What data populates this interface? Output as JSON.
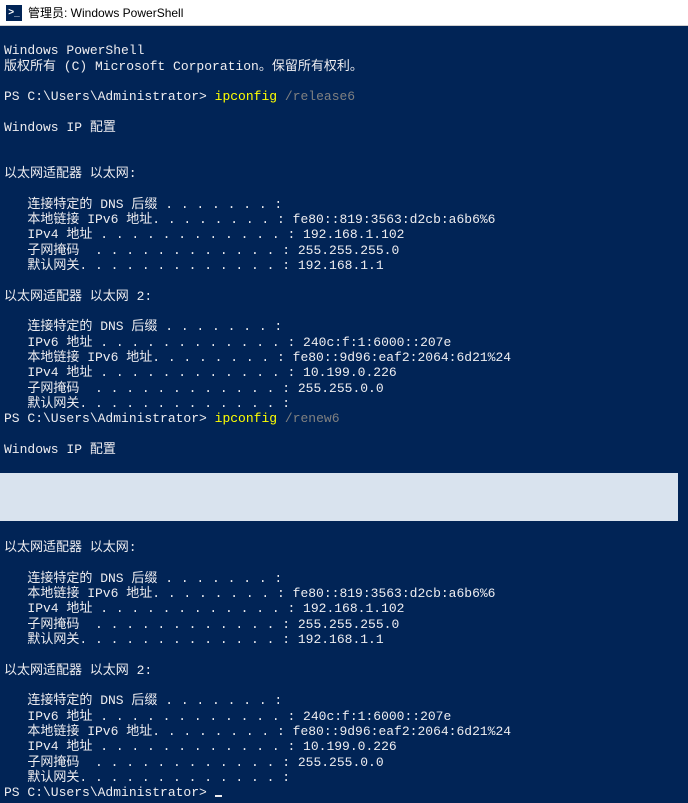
{
  "title_bar": {
    "icon_glyph": ">_",
    "title": "管理员: Windows PowerShell"
  },
  "header": {
    "line1": "Windows PowerShell",
    "line2": "版权所有 (C) Microsoft Corporation。保留所有权利。"
  },
  "prompt": {
    "path": "PS C:\\Users\\Administrator>"
  },
  "commands": {
    "cmd1_name": "ipconfig",
    "cmd1_arg": "/release6",
    "cmd2_name": "ipconfig",
    "cmd2_arg": "/renew6"
  },
  "labels": {
    "windows_ip_config": "Windows IP 配置",
    "adapter_eth": "以太网适配器 以太网:",
    "adapter_eth2": "以太网适配器 以太网 2:",
    "dns_suffix": "   连接特定的 DNS 后缀 . . . . . . . :",
    "link_local": "   本地链接 IPv6 地址. . . . . . . . :",
    "ipv6_addr": "   IPv6 地址 . . . . . . . . . . . . :",
    "ipv4_addr": "   IPv4 地址 . . . . . . . . . . . . :",
    "subnet": "   子网掩码  . . . . . . . . . . . . :",
    "gateway": "   默认网关. . . . . . . . . . . . . :"
  },
  "values": {
    "eth1_link_local": " fe80::819:3563:d2cb:a6b6%6",
    "eth1_ipv4": " 192.168.1.102",
    "eth1_subnet": " 255.255.255.0",
    "eth1_gateway": " 192.168.1.1",
    "eth2_ipv6": " 240c:f:1:6000::207e",
    "eth2_link_local": " fe80::9d96:eaf2:2064:6d21%24",
    "eth2_ipv4": " 10.199.0.226",
    "eth2_subnet": " 255.255.0.0",
    "eth2_gateway": ""
  }
}
